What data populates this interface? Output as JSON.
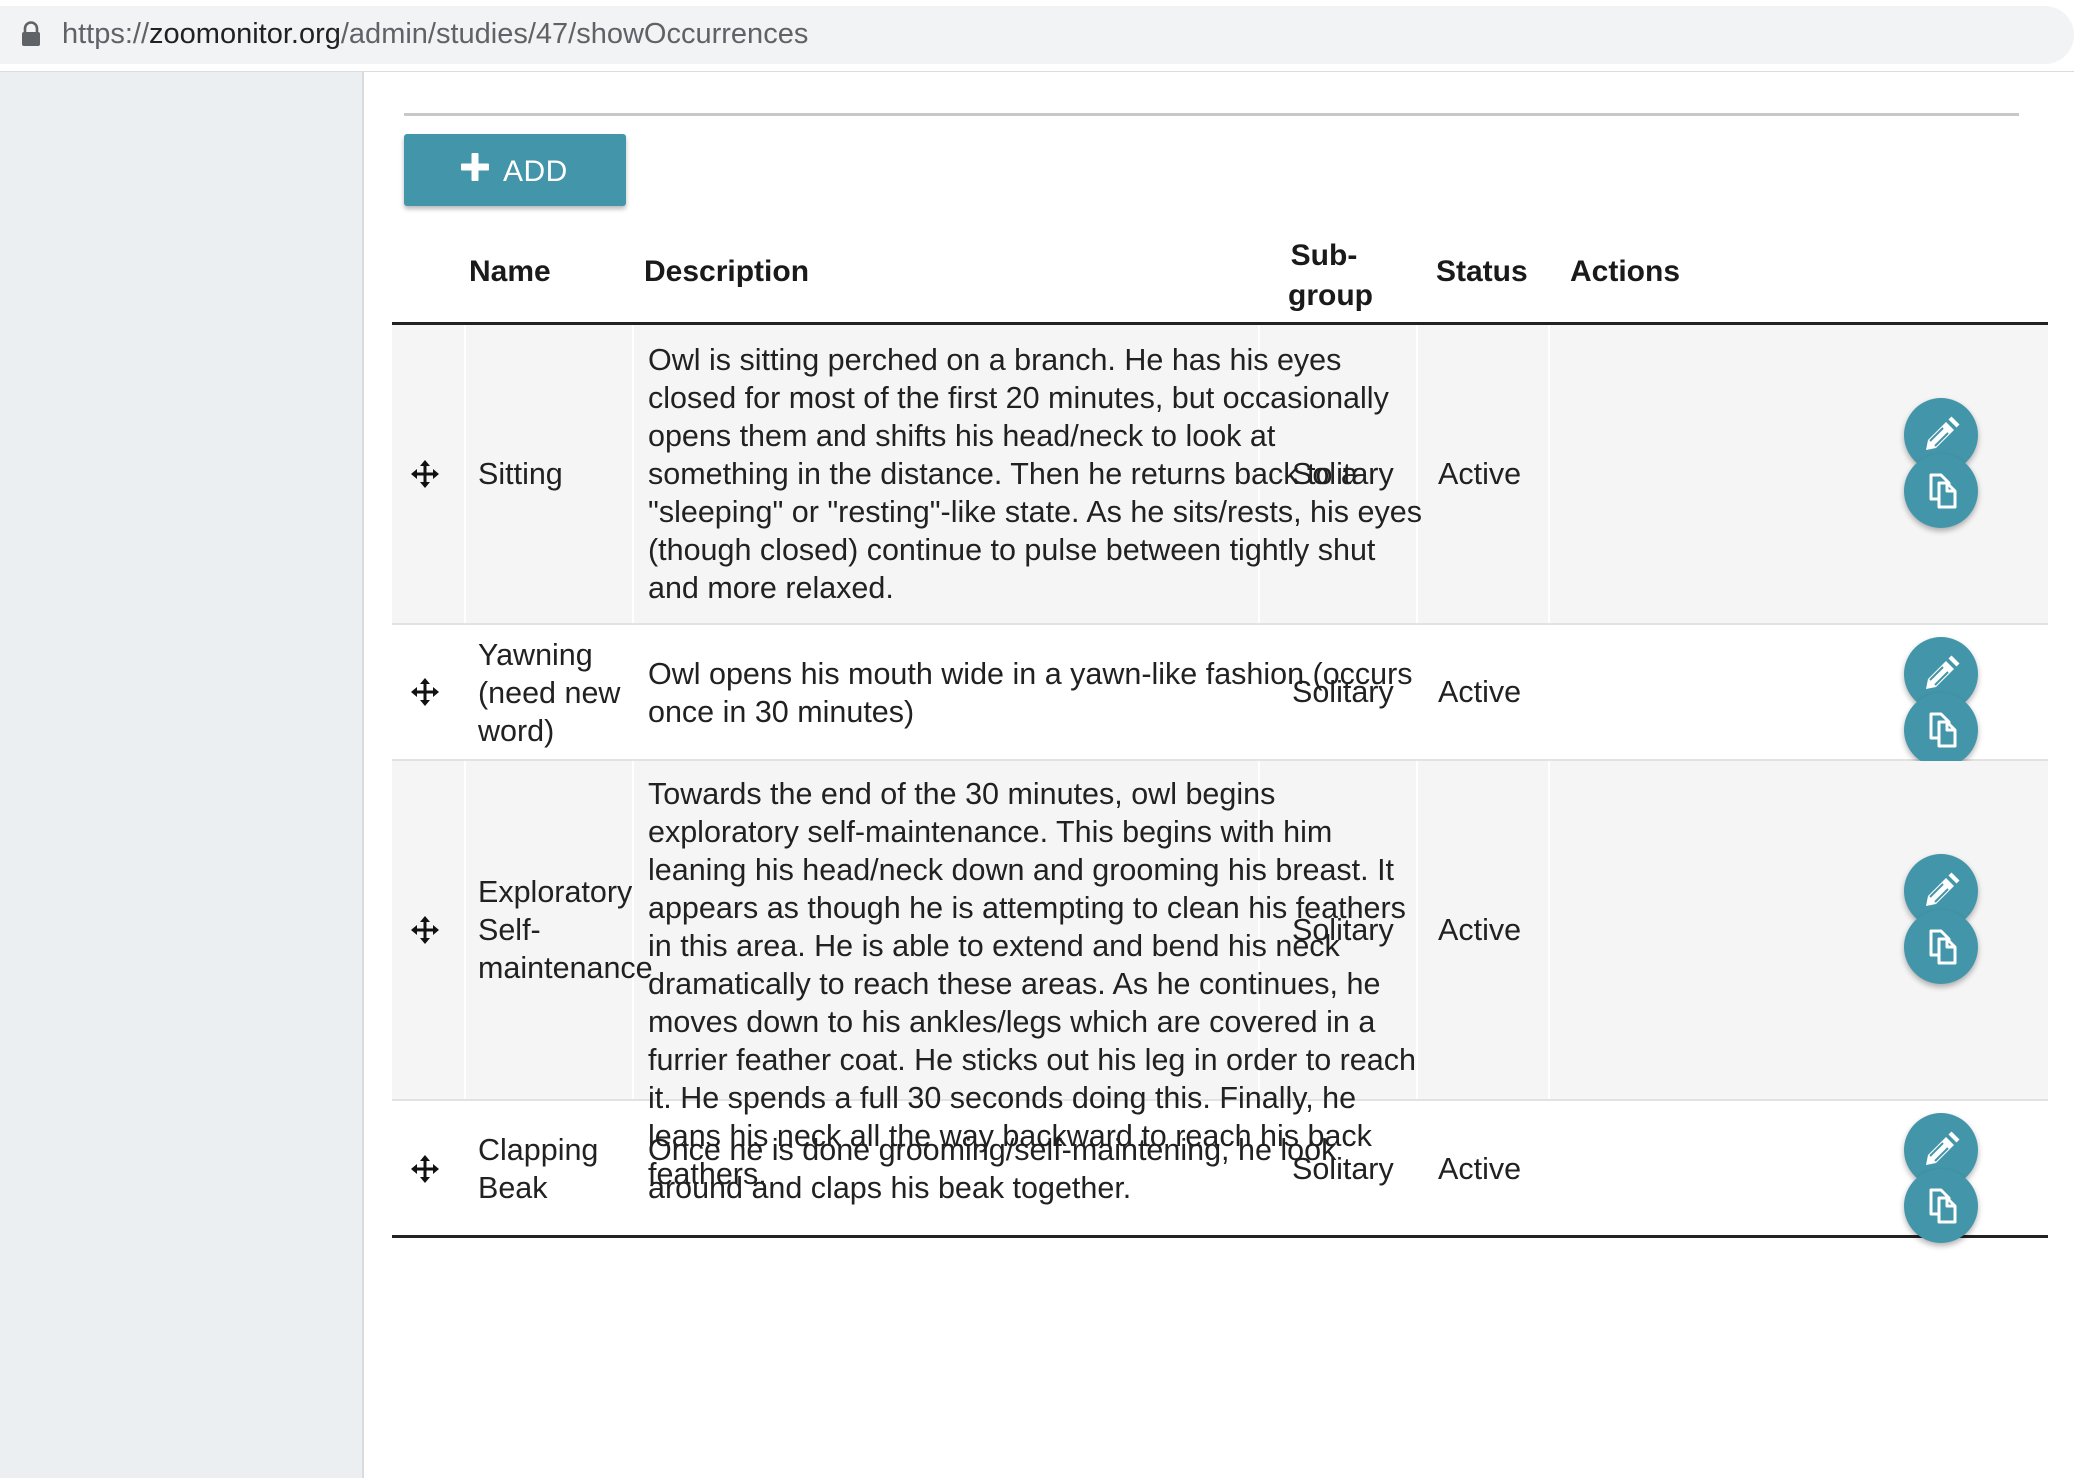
{
  "browser": {
    "url_scheme": "https://",
    "url_host": "zoomonitor.org",
    "url_path": "/admin/studies/47/showOccurrences"
  },
  "toolbar": {
    "add_label": "ADD"
  },
  "table": {
    "headers": {
      "name": "Name",
      "description": "Description",
      "subgroup_line1": "Sub-",
      "subgroup_line2": "group",
      "status": "Status",
      "actions": "Actions"
    },
    "rows": [
      {
        "name_lines": [
          "Sitting"
        ],
        "description_lines": [
          "Owl is sitting perched on a branch. He has his eyes",
          "closed for most of the first 20 minutes, but occasionally",
          "opens them and shifts his head/neck to look at",
          "something in the distance. Then he returns back to a",
          "\"sleeping\" or \"resting\"-like state. As he sits/rests, his eyes",
          "(though closed) continue to pulse between tightly shut",
          "and more relaxed."
        ],
        "subgroup": "Solitary",
        "status": "Active"
      },
      {
        "name_lines": [
          "Yawning",
          "(need new",
          "word)"
        ],
        "description_lines": [
          "Owl opens his mouth wide in a yawn-like fashion (occurs",
          "once in 30 minutes)"
        ],
        "subgroup": "Solitary",
        "status": "Active"
      },
      {
        "name_lines": [
          "Exploratory",
          "Self-",
          "maintenance"
        ],
        "description_lines": [
          "Towards the end of the 30 minutes, owl begins",
          "exploratory self-maintenance. This begins with him",
          "leaning his head/neck down and grooming his breast. It",
          "appears as though he is attempting to clean his feathers",
          "in this area. He is able to extend and bend his neck",
          "dramatically to reach these areas. As he continues, he",
          "moves down to his ankles/legs which are covered in a",
          "furrier feather coat. He sticks out his leg in order to reach",
          "it. He spends a full 30 seconds doing this. Finally, he",
          "leans his neck all the way backward to reach his back",
          "feathers."
        ],
        "subgroup": "Solitary",
        "status": "Active"
      },
      {
        "name_lines": [
          "Clapping",
          "Beak"
        ],
        "description_lines": [
          "Once he is done grooming/self-maintening, he look",
          "around and claps his beak together."
        ],
        "subgroup": "Solitary",
        "status": "Active"
      }
    ]
  },
  "icons": {
    "lock": "lock-icon",
    "add": "plus-icon",
    "drag": "drag-move-icon",
    "edit": "pencil-icon",
    "copy": "duplicate-icon"
  },
  "colors": {
    "accent": "#4396a9",
    "sidebar": "#eceff1",
    "row_shade": "#f5f5f5"
  }
}
